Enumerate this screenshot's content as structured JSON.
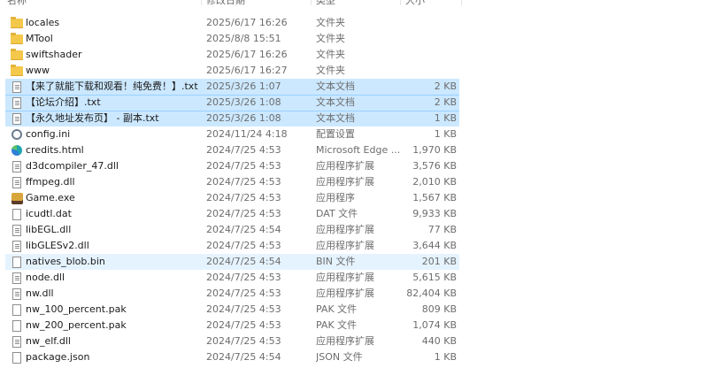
{
  "header": {
    "name": "名称",
    "date": "修改日期",
    "type": "类型",
    "size": "大小"
  },
  "rows": [
    {
      "icon": "folder-icon",
      "name": "locales",
      "date": "2025/6/17 16:26",
      "type": "文件夹",
      "size": "",
      "state": "normal"
    },
    {
      "icon": "folder-icon",
      "name": "MTool",
      "date": "2025/8/8 15:51",
      "type": "文件夹",
      "size": "",
      "state": "normal"
    },
    {
      "icon": "folder-icon",
      "name": "swiftshader",
      "date": "2025/6/17 16:26",
      "type": "文件夹",
      "size": "",
      "state": "normal"
    },
    {
      "icon": "folder-icon",
      "name": "www",
      "date": "2025/6/17 16:27",
      "type": "文件夹",
      "size": "",
      "state": "normal"
    },
    {
      "icon": "text-file-icon",
      "name": "【来了就能下载和观看！纯免费！】.txt",
      "date": "2025/3/26 1:07",
      "type": "文本文档",
      "size": "2 KB",
      "state": "selected"
    },
    {
      "icon": "text-file-icon",
      "name": "【论坛介绍】.txt",
      "date": "2025/3/26 1:08",
      "type": "文本文档",
      "size": "2 KB",
      "state": "selected"
    },
    {
      "icon": "text-file-icon",
      "name": "【永久地址发布页】 - 副本.txt",
      "date": "2025/3/26 1:08",
      "type": "文本文档",
      "size": "1 KB",
      "state": "selected"
    },
    {
      "icon": "settings-file-icon",
      "name": "config.ini",
      "date": "2024/11/24 4:18",
      "type": "配置设置",
      "size": "1 KB",
      "state": "normal"
    },
    {
      "icon": "edge-icon",
      "name": "credits.html",
      "date": "2024/7/25 4:53",
      "type": "Microsoft Edge ...",
      "size": "1,970 KB",
      "state": "normal"
    },
    {
      "icon": "dll-file-icon",
      "name": "d3dcompiler_47.dll",
      "date": "2024/7/25 4:53",
      "type": "应用程序扩展",
      "size": "3,576 KB",
      "state": "normal"
    },
    {
      "icon": "dll-file-icon",
      "name": "ffmpeg.dll",
      "date": "2024/7/25 4:53",
      "type": "应用程序扩展",
      "size": "2,010 KB",
      "state": "normal"
    },
    {
      "icon": "game-exe-icon",
      "name": "Game.exe",
      "date": "2024/7/25 4:53",
      "type": "应用程序",
      "size": "1,567 KB",
      "state": "normal"
    },
    {
      "icon": "file-icon",
      "name": "icudtl.dat",
      "date": "2024/7/25 4:53",
      "type": "DAT 文件",
      "size": "9,933 KB",
      "state": "normal"
    },
    {
      "icon": "dll-file-icon",
      "name": "libEGL.dll",
      "date": "2024/7/25 4:54",
      "type": "应用程序扩展",
      "size": "77 KB",
      "state": "normal"
    },
    {
      "icon": "dll-file-icon",
      "name": "libGLESv2.dll",
      "date": "2024/7/25 4:53",
      "type": "应用程序扩展",
      "size": "3,644 KB",
      "state": "normal"
    },
    {
      "icon": "file-icon",
      "name": "natives_blob.bin",
      "date": "2024/7/25 4:54",
      "type": "BIN 文件",
      "size": "201 KB",
      "state": "hover"
    },
    {
      "icon": "dll-file-icon",
      "name": "node.dll",
      "date": "2024/7/25 4:53",
      "type": "应用程序扩展",
      "size": "5,615 KB",
      "state": "normal"
    },
    {
      "icon": "dll-file-icon",
      "name": "nw.dll",
      "date": "2024/7/25 4:53",
      "type": "应用程序扩展",
      "size": "82,404 KB",
      "state": "normal"
    },
    {
      "icon": "file-icon",
      "name": "nw_100_percent.pak",
      "date": "2024/7/25 4:53",
      "type": "PAK 文件",
      "size": "809 KB",
      "state": "normal"
    },
    {
      "icon": "file-icon",
      "name": "nw_200_percent.pak",
      "date": "2024/7/25 4:53",
      "type": "PAK 文件",
      "size": "1,074 KB",
      "state": "normal"
    },
    {
      "icon": "dll-file-icon",
      "name": "nw_elf.dll",
      "date": "2024/7/25 4:53",
      "type": "应用程序扩展",
      "size": "440 KB",
      "state": "normal"
    },
    {
      "icon": "file-icon",
      "name": "package.json",
      "date": "2024/7/25 4:54",
      "type": "JSON 文件",
      "size": "1 KB",
      "state": "normal"
    }
  ]
}
